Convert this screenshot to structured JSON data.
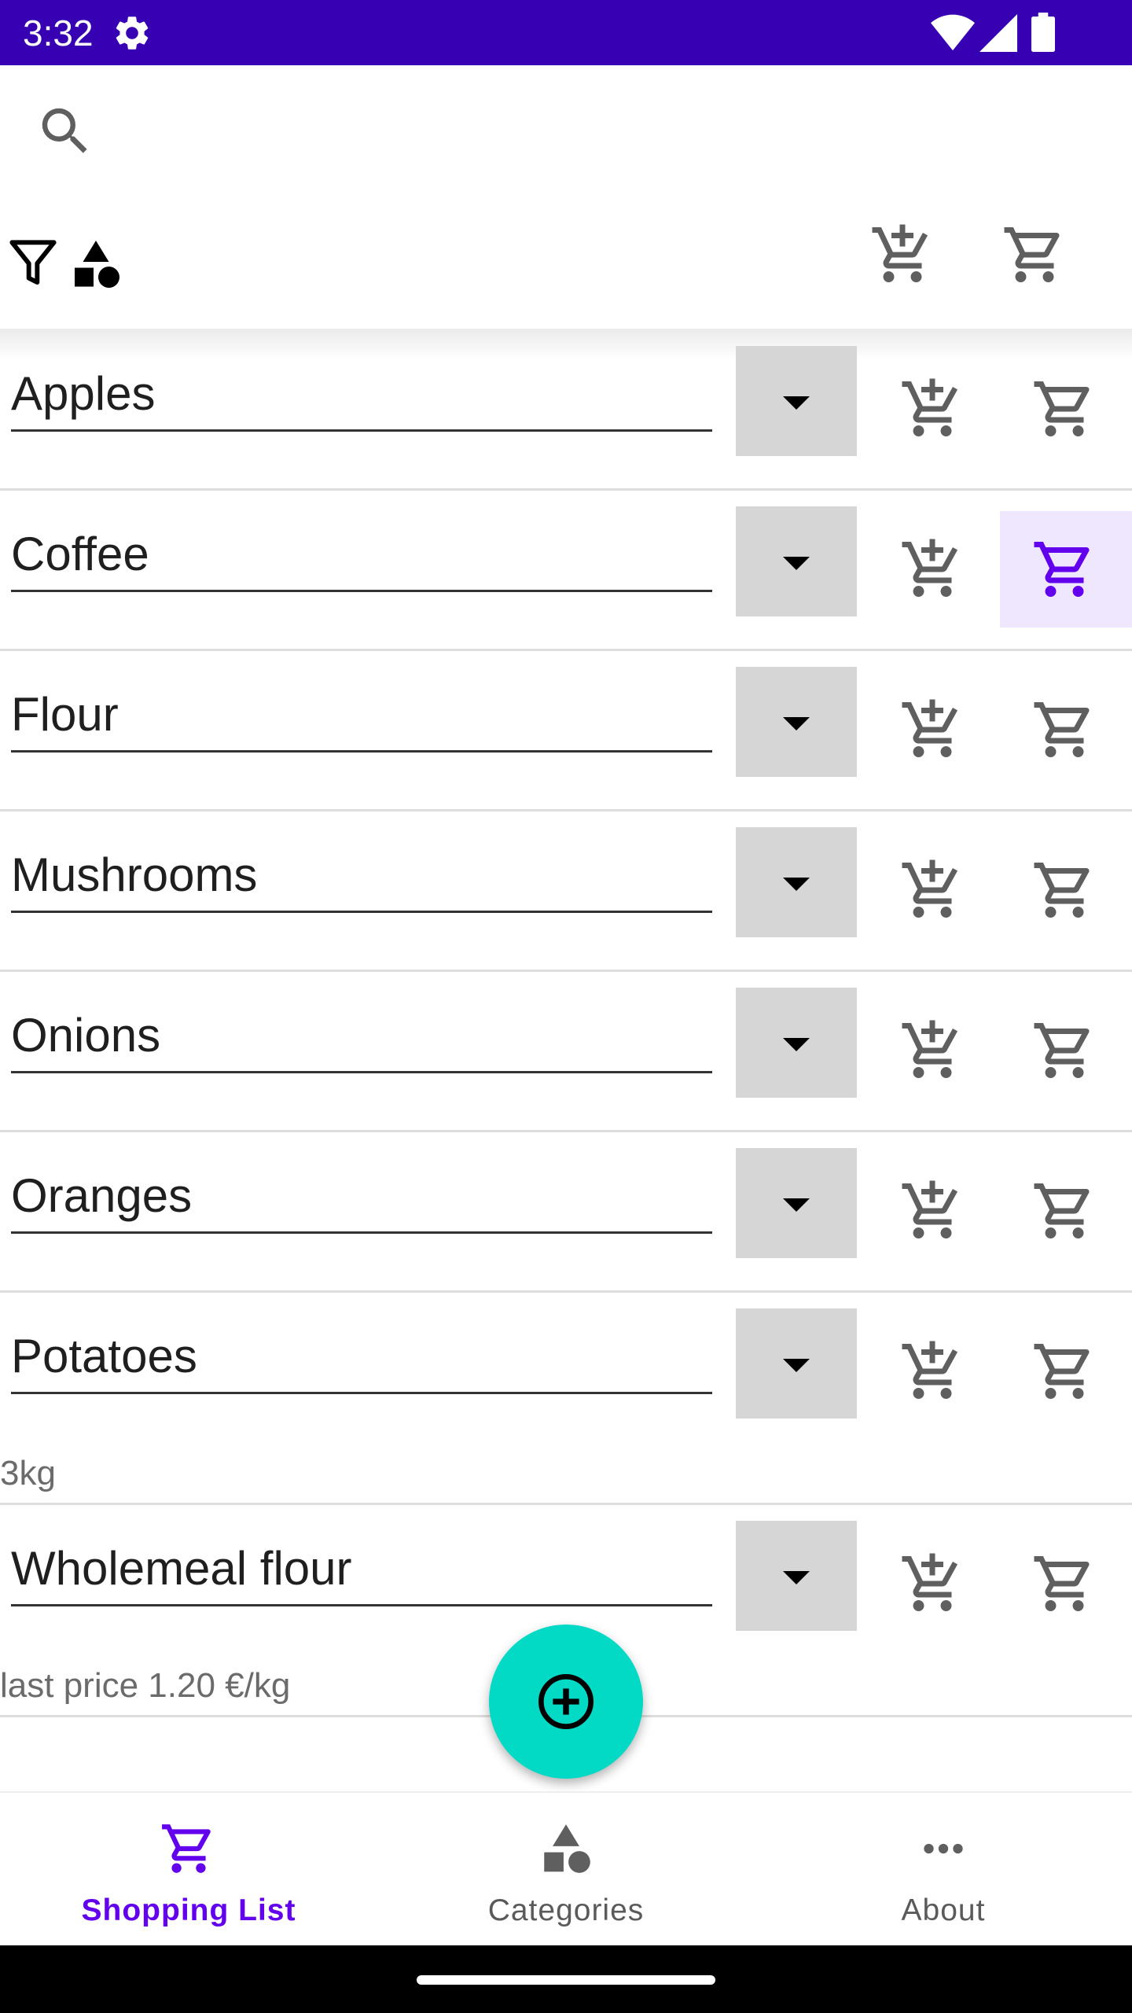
{
  "status_bar": {
    "time": "3:32",
    "icons": [
      "settings-gear-icon",
      "wifi-icon",
      "cell-signal-icon",
      "battery-icon"
    ]
  },
  "toolbar": {
    "search_icon": "search-icon",
    "filter_icon": "filter-icon",
    "categories_icon": "shapes-icon",
    "header_icons": [
      "add-shopping-cart-icon",
      "shopping-cart-icon"
    ]
  },
  "items": [
    {
      "name": "Apples",
      "sub": "",
      "cart_selected": false
    },
    {
      "name": "Coffee",
      "sub": "",
      "cart_selected": true
    },
    {
      "name": "Flour",
      "sub": "",
      "cart_selected": false
    },
    {
      "name": "Mushrooms",
      "sub": "",
      "cart_selected": false
    },
    {
      "name": "Onions",
      "sub": "",
      "cart_selected": false
    },
    {
      "name": "Oranges",
      "sub": "",
      "cart_selected": false
    },
    {
      "name": "Potatoes",
      "sub": "3kg",
      "cart_selected": false
    },
    {
      "name": "Wholemeal flour",
      "sub": "last price 1.20 €/kg",
      "cart_selected": false
    }
  ],
  "fab": {
    "icon": "add-circle-icon"
  },
  "bottom_nav": [
    {
      "label": "Shopping List",
      "icon": "shopping-cart-icon",
      "active": true
    },
    {
      "label": "Categories",
      "icon": "category-shapes-icon",
      "active": false
    },
    {
      "label": "About",
      "icon": "more-horiz-icon",
      "active": false
    }
  ],
  "colors": {
    "status_bar": "#3700b3",
    "accent": "#6200ee",
    "fab": "#03dac5",
    "selected_bg": "#eee7fd",
    "icon_gray": "#5f5f5f"
  }
}
